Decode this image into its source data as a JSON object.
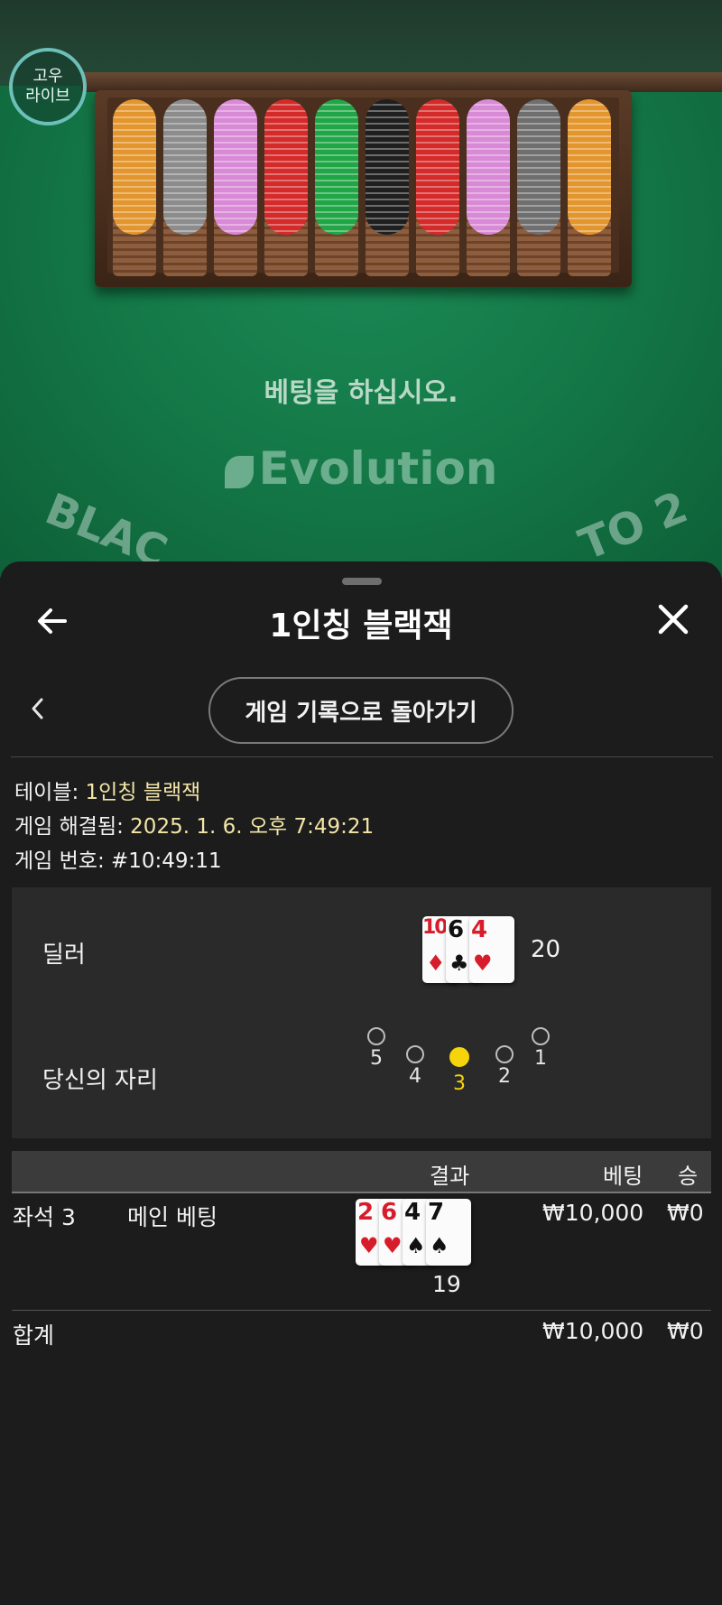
{
  "background": {
    "logo": {
      "line1": "고우",
      "line2": "라이브"
    },
    "prompt": "베팅을 하십시오.",
    "brand": "Evolution",
    "arc_left": "BLAC",
    "arc_right": "TO 2",
    "chip_colors": [
      "#e3962e",
      "#8c8c8c",
      "#d98ad6",
      "#d42a2a",
      "#20a646",
      "#1f1f1f",
      "#d42a2a",
      "#d98ad6",
      "#6f6f6f",
      "#e3962e"
    ]
  },
  "sheet": {
    "title": "1인칭 블랙잭",
    "history_button": "게임 기록으로 돌아가기",
    "info": {
      "table_label": "테이블: ",
      "table_value": "1인칭 블랙잭",
      "resolved_label": "게임 해결됨: ",
      "resolved_value": "2025. 1. 6. 오후 7:49:21",
      "number_label": "게임 번호: ",
      "number_value": "#10:49:11"
    },
    "dealer": {
      "label": "딜러",
      "score": "20",
      "cards": [
        {
          "rank": "10",
          "suit": "♦",
          "color": "red"
        },
        {
          "rank": "6",
          "suit": "♣",
          "color": "black"
        },
        {
          "rank": "4",
          "suit": "♥",
          "color": "red"
        }
      ]
    },
    "seat_row": {
      "label": "당신의 자리",
      "seats": [
        "5",
        "4",
        "3",
        "2",
        "1"
      ],
      "selected": "3"
    },
    "table": {
      "headers": {
        "result": "결과",
        "bet": "베팅",
        "win": "승"
      },
      "row": {
        "seat": "좌석 3",
        "bet_type": "메인 베팅",
        "score": "19",
        "bet": "₩10,000",
        "win": "₩0",
        "cards": [
          {
            "rank": "2",
            "suit": "♥",
            "color": "red"
          },
          {
            "rank": "6",
            "suit": "♥",
            "color": "red"
          },
          {
            "rank": "4",
            "suit": "♠",
            "color": "black"
          },
          {
            "rank": "7",
            "suit": "♠",
            "color": "black"
          }
        ]
      },
      "total": {
        "label": "합계",
        "bet": "₩10,000",
        "win": "₩0"
      }
    }
  }
}
